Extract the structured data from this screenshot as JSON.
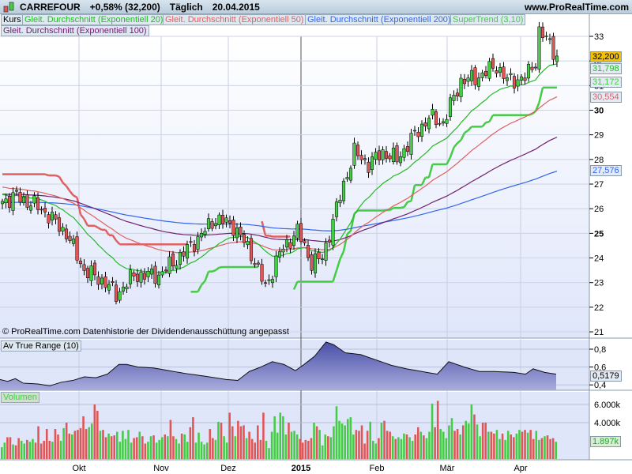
{
  "header": {
    "symbol": "CARREFOUR",
    "change": "+0,58% (32,200)",
    "period": "Täglich",
    "date": "20.04.2015",
    "site": "www.ProRealTime.com"
  },
  "legend": {
    "kurs": "Kurs",
    "ema20": "Gleit. Durchschnitt (Exponentiell 20)",
    "ema50": "Gleit. Durchschnitt (Exponentiell 50)",
    "ema200": "Gleit. Durchschnitt (Exponentiell 200)",
    "supertrend": "SuperTrend (3,10)",
    "ema100": "Gleit. Durchschnitt (Exponentiell 100)"
  },
  "footer_note": "© ProRealTime.com  Datenhistorie der Dividendenausschüttung angepasst",
  "colors": {
    "ema20": "#22bb22",
    "ema50": "#e06060",
    "ema100": "#702070",
    "ema200": "#3366ee",
    "supertrend": "#44cc44",
    "up": "#44cc44",
    "down": "#e05555",
    "atr": "#5a5fb0"
  },
  "chart_data": [
    {
      "type": "candlestick",
      "title": "CARREFOUR",
      "ylim": [
        21,
        33.5
      ],
      "yticks": [
        "33",
        "32",
        "31",
        "30",
        "29",
        "28",
        "27",
        "26",
        "25",
        "24",
        "23",
        "22",
        "21"
      ],
      "xticks": [
        "Okt",
        "Nov",
        "Dez",
        "2015",
        "Feb",
        "Mär",
        "Apr"
      ],
      "price_keypoints_bar_close": [
        [
          0,
          26.3
        ],
        [
          4,
          26.5
        ],
        [
          11,
          26
        ],
        [
          18,
          25
        ],
        [
          23,
          23.5
        ],
        [
          29,
          23
        ],
        [
          32,
          22.5
        ],
        [
          37,
          23.3
        ],
        [
          44,
          23.3
        ],
        [
          51,
          24.2
        ],
        [
          55,
          24.8
        ],
        [
          60,
          25.6
        ],
        [
          65,
          25.3
        ],
        [
          70,
          24.2
        ],
        [
          74,
          22.8
        ],
        [
          78,
          24.2
        ],
        [
          83,
          25.1
        ],
        [
          87,
          23.8
        ],
        [
          90,
          24
        ],
        [
          93,
          25.5
        ],
        [
          96,
          27
        ],
        [
          99,
          28.3
        ],
        [
          103,
          27.8
        ],
        [
          107,
          28.3
        ],
        [
          111,
          28
        ],
        [
          116,
          29
        ],
        [
          120,
          29.7
        ],
        [
          124,
          29.5
        ],
        [
          129,
          31.2
        ],
        [
          133,
          31.3
        ],
        [
          139,
          31.8
        ],
        [
          142,
          31.2
        ],
        [
          147,
          31.3
        ],
        [
          150,
          32
        ],
        [
          151,
          33.2
        ],
        [
          154,
          32.7
        ],
        [
          156,
          32.2
        ]
      ],
      "last_values": {
        "close": "32,200",
        "ema20": "31,798",
        "supertrend": "31,172",
        "ema50": "30,554",
        "ema200": "27,576"
      }
    },
    {
      "type": "area",
      "title": "Av True Range (10)",
      "ylim": [
        0.35,
        0.9
      ],
      "yticks": [
        "0,8",
        "0,6",
        "0,4"
      ],
      "last": "0,5179",
      "keypoints": [
        [
          0,
          0.46
        ],
        [
          4,
          0.44
        ],
        [
          8,
          0.47
        ],
        [
          12,
          0.42
        ],
        [
          20,
          0.41
        ],
        [
          26,
          0.39
        ],
        [
          32,
          0.43
        ],
        [
          38,
          0.45
        ],
        [
          44,
          0.49
        ],
        [
          50,
          0.48
        ],
        [
          56,
          0.52
        ],
        [
          62,
          0.63
        ],
        [
          66,
          0.63
        ],
        [
          72,
          0.6
        ],
        [
          80,
          0.59
        ],
        [
          88,
          0.56
        ],
        [
          96,
          0.53
        ],
        [
          106,
          0.5
        ],
        [
          112,
          0.48
        ],
        [
          118,
          0.46
        ],
        [
          124,
          0.45
        ],
        [
          130,
          0.55
        ],
        [
          136,
          0.6
        ],
        [
          142,
          0.66
        ],
        [
          148,
          0.63
        ],
        [
          154,
          0.56
        ],
        [
          158,
          0.62
        ],
        [
          164,
          0.72
        ],
        [
          170,
          0.88
        ],
        [
          174,
          0.85
        ],
        [
          180,
          0.76
        ],
        [
          188,
          0.74
        ],
        [
          196,
          0.68
        ],
        [
          204,
          0.62
        ],
        [
          212,
          0.58
        ],
        [
          220,
          0.55
        ],
        [
          228,
          0.52
        ],
        [
          234,
          0.66
        ],
        [
          242,
          0.6
        ],
        [
          250,
          0.55
        ],
        [
          258,
          0.55
        ],
        [
          268,
          0.54
        ],
        [
          274,
          0.52
        ],
        [
          278,
          0.58
        ],
        [
          284,
          0.54
        ],
        [
          290,
          0.52
        ]
      ]
    },
    {
      "type": "bar",
      "title": "Volumen",
      "yticks": [
        "6.000k",
        "4.000k"
      ],
      "last": "1.897k",
      "values_k": [
        1300,
        1800,
        2400,
        2400,
        1600,
        1500,
        2300,
        2000,
        1700,
        2100,
        1900,
        2200,
        1800,
        3600,
        1700,
        2000,
        3300,
        2000,
        1900,
        3300,
        2700,
        2000,
        3400,
        4000,
        2800,
        2700,
        3100,
        3200,
        3400,
        4700,
        3300,
        3500,
        3900,
        6000,
        5300,
        3100,
        3200,
        2400,
        2800,
        2500,
        2600,
        3000,
        1900,
        3100,
        2200,
        3200,
        1800,
        2300,
        2400,
        3000,
        2500,
        1700,
        1900,
        2500,
        2600,
        1800,
        2100,
        2400,
        2700,
        2500,
        4300,
        2500,
        2200,
        1700,
        2800,
        2700,
        1900,
        3500,
        4600,
        1800,
        2900,
        1900,
        1600,
        1800,
        3300,
        2300,
        2100,
        4100,
        4000,
        2500,
        1800,
        5100,
        3600,
        2500,
        4200,
        3600,
        3700,
        2300,
        3000,
        2200,
        1800,
        3700,
        2100,
        5100,
        2000,
        1200,
        3000,
        4700,
        2900,
        5100,
        4700,
        2700,
        4000,
        3000,
        3100,
        2700,
        2200,
        1800,
        2100,
        2000,
        2300,
        4000,
        3600,
        3200,
        1500,
        2700,
        2500,
        2400,
        3600,
        5800,
        4200,
        3900,
        3700,
        4400,
        4600,
        2700,
        3200,
        3100,
        3700,
        1700,
        3100,
        4100,
        2000,
        1700,
        2300,
        4000,
        4200,
        3100,
        3000,
        2500,
        2200,
        2400,
        2200,
        2800,
        2700,
        2400,
        2000,
        2700,
        3500,
        3000,
        2600,
        2300,
        3000,
        6100,
        3500,
        6400,
        3300,
        3000,
        2300,
        3700,
        4500,
        3100,
        3300,
        2700,
        3700,
        4200,
        3900,
        6000,
        4900,
        3800,
        2500,
        4000,
        4000,
        3000,
        3000,
        2800,
        3200,
        2200,
        2800,
        2100,
        3100,
        2700,
        2400,
        2800,
        3200,
        3000,
        3200,
        2900,
        3200,
        2200,
        3100,
        2100,
        2300,
        2500,
        2600,
        2200,
        2300,
        1897
      ],
      "colors_seq": "rgggrrgrrrggrrrggrggrggrrgrrgggrgrrggrgrrrggrggrrgrrrgrggggrgrrrgggr"
    }
  ]
}
